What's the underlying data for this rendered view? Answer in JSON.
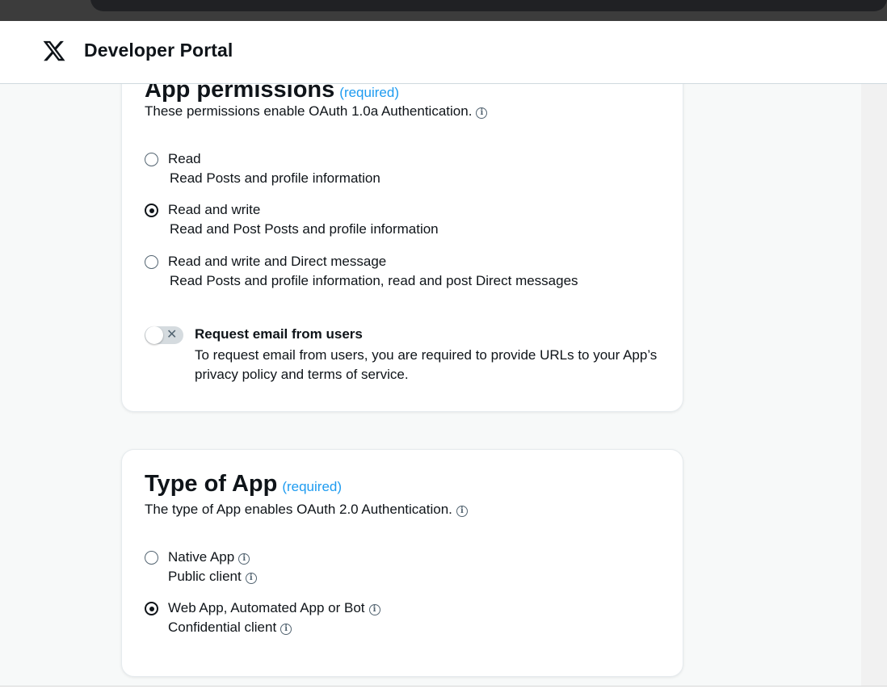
{
  "header": {
    "title": "Developer Portal",
    "logo_icon": "x-logo-icon"
  },
  "app_permissions": {
    "heading": "App permissions",
    "required": "(required)",
    "subtitle": "These permissions enable OAuth 1.0a Authentication.",
    "options": [
      {
        "label": "Read",
        "description": "Read Posts and profile information",
        "selected": false
      },
      {
        "label": "Read and write",
        "description": "Read and Post Posts and profile information",
        "selected": true
      },
      {
        "label": "Read and write and Direct message",
        "description": "Read Posts and profile information, read and post Direct messages",
        "selected": false
      }
    ],
    "email_toggle": {
      "label": "Request email from users",
      "description": "To request email from users, you are required to provide URLs to your App’s privacy policy and terms of service.",
      "on": false
    }
  },
  "type_of_app": {
    "heading": "Type of App",
    "required": "(required)",
    "subtitle": "The type of App enables OAuth 2.0 Authentication.",
    "options": [
      {
        "label": "Native App",
        "description": "Public client",
        "selected": false
      },
      {
        "label": "Web App, Automated App or Bot",
        "description": "Confidential client",
        "selected": true
      }
    ]
  },
  "colors": {
    "accent": "#1d9bf0",
    "text": "#0f1419",
    "toggle_off": "#d5dbdf"
  }
}
